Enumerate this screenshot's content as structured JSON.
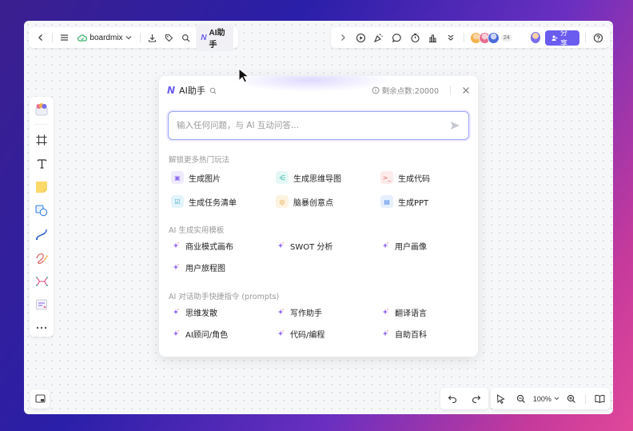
{
  "topbar_left": {
    "board_name": "boardmix",
    "ai_button_label": "AI助手",
    "ai_logo_text": "N"
  },
  "topbar_right": {
    "collaborator_count": "24",
    "share_label": "分享",
    "avatar_colors": [
      "#f3b24a",
      "#e86f8f",
      "#4a6bd8"
    ]
  },
  "ai_panel": {
    "title": "AI助手",
    "logo_text": "N",
    "points_label": "剩余点数:20000",
    "input_placeholder": "输入任何问题，与 AI 互动问答...",
    "section_hot": "解锁更多热门玩法",
    "hot_features": [
      {
        "label": "生成图片",
        "icon": "image-icon",
        "color": "#8f6cf0",
        "bg": "#efeafd",
        "glyph": "▣"
      },
      {
        "label": "生成思维导图",
        "icon": "mindmap-icon",
        "color": "#2ab3a8",
        "bg": "#e4f7f5",
        "glyph": "⋲"
      },
      {
        "label": "生成代码",
        "icon": "code-icon",
        "color": "#e06a6a",
        "bg": "#fdebeb",
        "glyph": ">_"
      },
      {
        "label": "生成任务清单",
        "icon": "checklist-icon",
        "color": "#2fa7c9",
        "bg": "#e3f4fa",
        "glyph": "☑"
      },
      {
        "label": "脑暴创意点",
        "icon": "lightbulb-icon",
        "color": "#e3a53a",
        "bg": "#fdf3e1",
        "glyph": "◎"
      },
      {
        "label": "生成PPT",
        "icon": "ppt-icon",
        "color": "#4a86e8",
        "bg": "#e6effc",
        "glyph": "▤"
      }
    ],
    "section_templates": "AI 生成实用模板",
    "templates": [
      "商业模式画布",
      "SWOT 分析",
      "用户画像",
      "用户旅程图"
    ],
    "section_prompts": "AI 对话助手快捷指令 (prompts)",
    "prompts": [
      "思维发散",
      "写作助手",
      "翻译语言",
      "AI顾问/角色",
      "代码/编程",
      "自助百科"
    ]
  },
  "zoom": {
    "level": "100%"
  },
  "colors": {
    "accent": "#6b5cf0",
    "input_border": "#9aa8f5"
  }
}
